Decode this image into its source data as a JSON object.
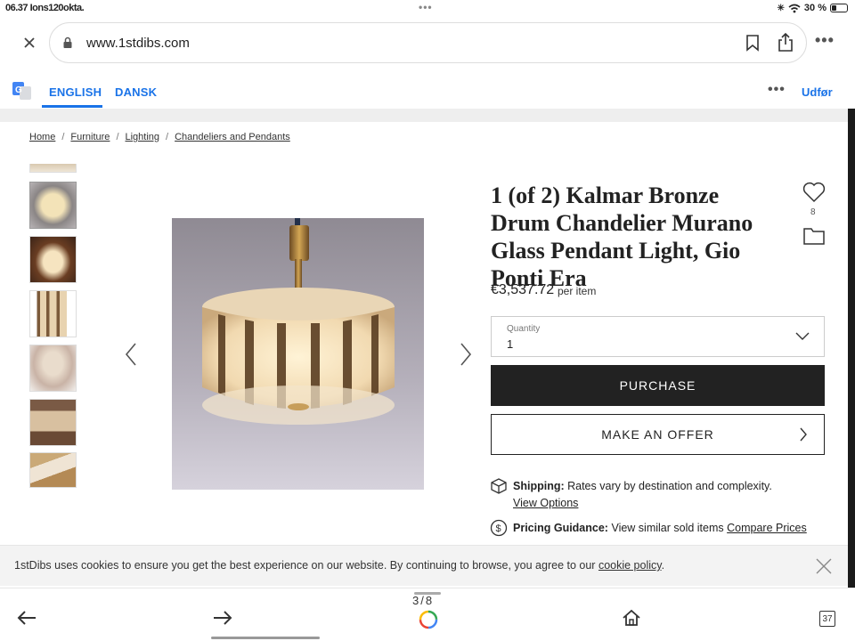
{
  "status": {
    "time": "06.37  Ions120okta.",
    "battery": "30 %",
    "battery_level": 0.3
  },
  "browser": {
    "url": "www.1stdibs.com"
  },
  "translate": {
    "lang_active": "ENGLISH",
    "lang_other": "DANSK",
    "done": "Udfør"
  },
  "breadcrumb": [
    "Home",
    "Furniture",
    "Lighting",
    "Chandeliers and Pendants"
  ],
  "breadcrumb_sep": "/",
  "product": {
    "title": "1 (of 2) Kalmar Bronze Drum Chandelier Murano Glass Pendant Light, Gio Ponti Era",
    "favorites": "8",
    "price": "€3,537.72",
    "per_item": "per item",
    "quantity_label": "Quantity",
    "quantity_value": "1",
    "purchase": "PURCHASE",
    "offer": "MAKE AN OFFER",
    "shipping_label": "Shipping:",
    "shipping_text": "Rates vary by destination and complexity.",
    "shipping_link": "View Options",
    "pricing_label": "Pricing Guidance:",
    "pricing_text": "View similar sold items",
    "pricing_link": "Compare Prices"
  },
  "cookie": {
    "text": "1stDibs uses cookies to ensure you get the best experience on our website. By continuing to browse, you agree to our",
    "link": "cookie policy",
    "end": "."
  },
  "toolbar": {
    "tabs_indicator": "3/8",
    "tab_count": "37"
  },
  "colors": {
    "accent": "#1a73e8",
    "button_dark": "#222222"
  }
}
